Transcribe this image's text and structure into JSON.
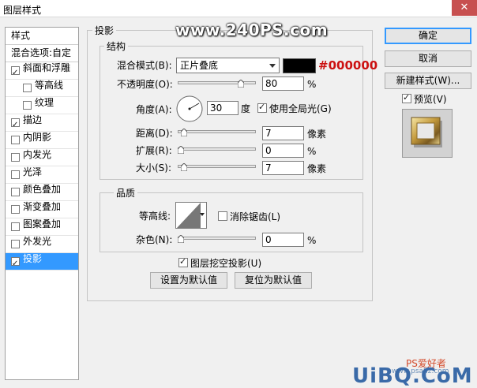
{
  "window": {
    "title": "图层样式",
    "close_glyph": "✕"
  },
  "watermark": {
    "site": "www.240PS.com",
    "brand": "UiBQ.CoM",
    "brand_cn": "PS爱好者",
    "url_small": "www.psahz.com"
  },
  "left_list": {
    "header1": "样式",
    "header2": "混合选项:自定",
    "items": [
      {
        "label": "斜面和浮雕",
        "checked": true,
        "indent": 0
      },
      {
        "label": "等高线",
        "checked": false,
        "indent": 1
      },
      {
        "label": "纹理",
        "checked": false,
        "indent": 1
      },
      {
        "label": "描边",
        "checked": true,
        "indent": 0
      },
      {
        "label": "内阴影",
        "checked": false,
        "indent": 0
      },
      {
        "label": "内发光",
        "checked": false,
        "indent": 0
      },
      {
        "label": "光泽",
        "checked": false,
        "indent": 0
      },
      {
        "label": "颜色叠加",
        "checked": false,
        "indent": 0
      },
      {
        "label": "渐变叠加",
        "checked": false,
        "indent": 0
      },
      {
        "label": "图案叠加",
        "checked": false,
        "indent": 0
      },
      {
        "label": "外发光",
        "checked": false,
        "indent": 0
      },
      {
        "label": "投影",
        "checked": true,
        "indent": 0,
        "selected": true
      }
    ]
  },
  "drop_shadow": {
    "title": "投影",
    "structure": {
      "title": "结构",
      "blend_mode_label": "混合模式(B):",
      "blend_mode_value": "正片叠底",
      "color_hex": "#000000",
      "opacity_label": "不透明度(O):",
      "opacity_value": "80",
      "opacity_unit": "%",
      "opacity_fraction": 0.8,
      "angle_label": "角度(A):",
      "angle_value": "30",
      "angle_unit": "度",
      "global_light_label": "使用全局光(G)",
      "global_light_checked": true,
      "distance_label": "距离(D):",
      "distance_value": "7",
      "distance_unit": "像素",
      "spread_label": "扩展(R):",
      "spread_value": "0",
      "spread_unit": "%",
      "size_label": "大小(S):",
      "size_value": "7",
      "size_unit": "像素"
    },
    "quality": {
      "title": "品质",
      "contour_label": "等高线:",
      "antialias_label": "消除锯齿(L)",
      "antialias_checked": false,
      "noise_label": "杂色(N):",
      "noise_value": "0",
      "noise_unit": "%"
    },
    "knockout_label": "图层挖空投影(U)",
    "knockout_checked": true,
    "set_default": "设置为默认值",
    "reset_default": "复位为默认值"
  },
  "buttons": {
    "ok": "确定",
    "cancel": "取消",
    "new_style": "新建样式(W)...",
    "preview_label": "预览(V)",
    "preview_checked": true
  },
  "colors": {
    "accent": "#3399ff",
    "hex_annotation": "#cc1111",
    "close": "#c75050"
  }
}
